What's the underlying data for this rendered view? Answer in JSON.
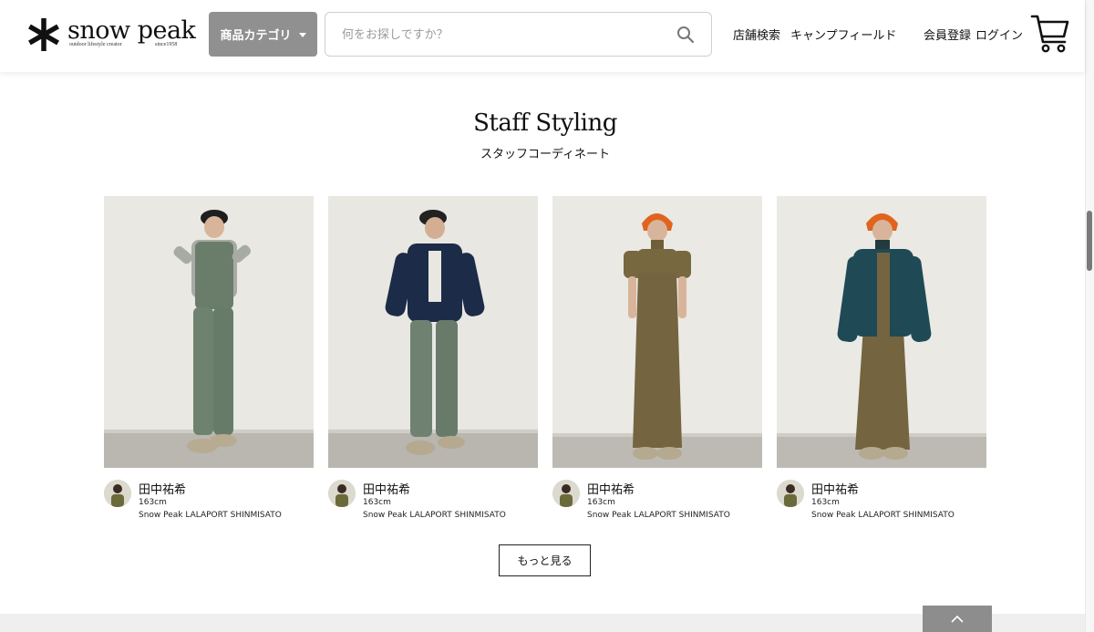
{
  "header": {
    "logo": {
      "wordmark": "snow peak",
      "tagline": "outdoor lifestyle creator",
      "since": "since1958"
    },
    "category_button": "商品カテゴリ",
    "search": {
      "placeholder": "何をお探しですか？",
      "value": ""
    },
    "nav": {
      "store_search": "店舗検索",
      "camp_field": "キャンプフィールド",
      "register": "会員登録",
      "login": "ログイン"
    },
    "icons": [
      "snowflake-logo-icon",
      "chevron-down-icon",
      "search-icon",
      "cart-icon"
    ]
  },
  "section": {
    "title": "Staff Styling",
    "subtitle": "スタッフコーディネート",
    "more_button": "もっと見る"
  },
  "cards": [
    {
      "name": "田中祐希",
      "height": "163cm",
      "store": "Snow Peak LALAPORT SHINMISATO"
    },
    {
      "name": "田中祐希",
      "height": "163cm",
      "store": "Snow Peak LALAPORT SHINMISATO"
    },
    {
      "name": "田中祐希",
      "height": "163cm",
      "store": "Snow Peak LALAPORT SHINMISATO"
    },
    {
      "name": "田中祐希",
      "height": "163cm",
      "store": "Snow Peak LALAPORT SHINMISATO"
    }
  ],
  "colors": {
    "category_button_bg": "#909090",
    "page_top_bg": "#8d8d8d",
    "footer_bg": "#efefef"
  }
}
